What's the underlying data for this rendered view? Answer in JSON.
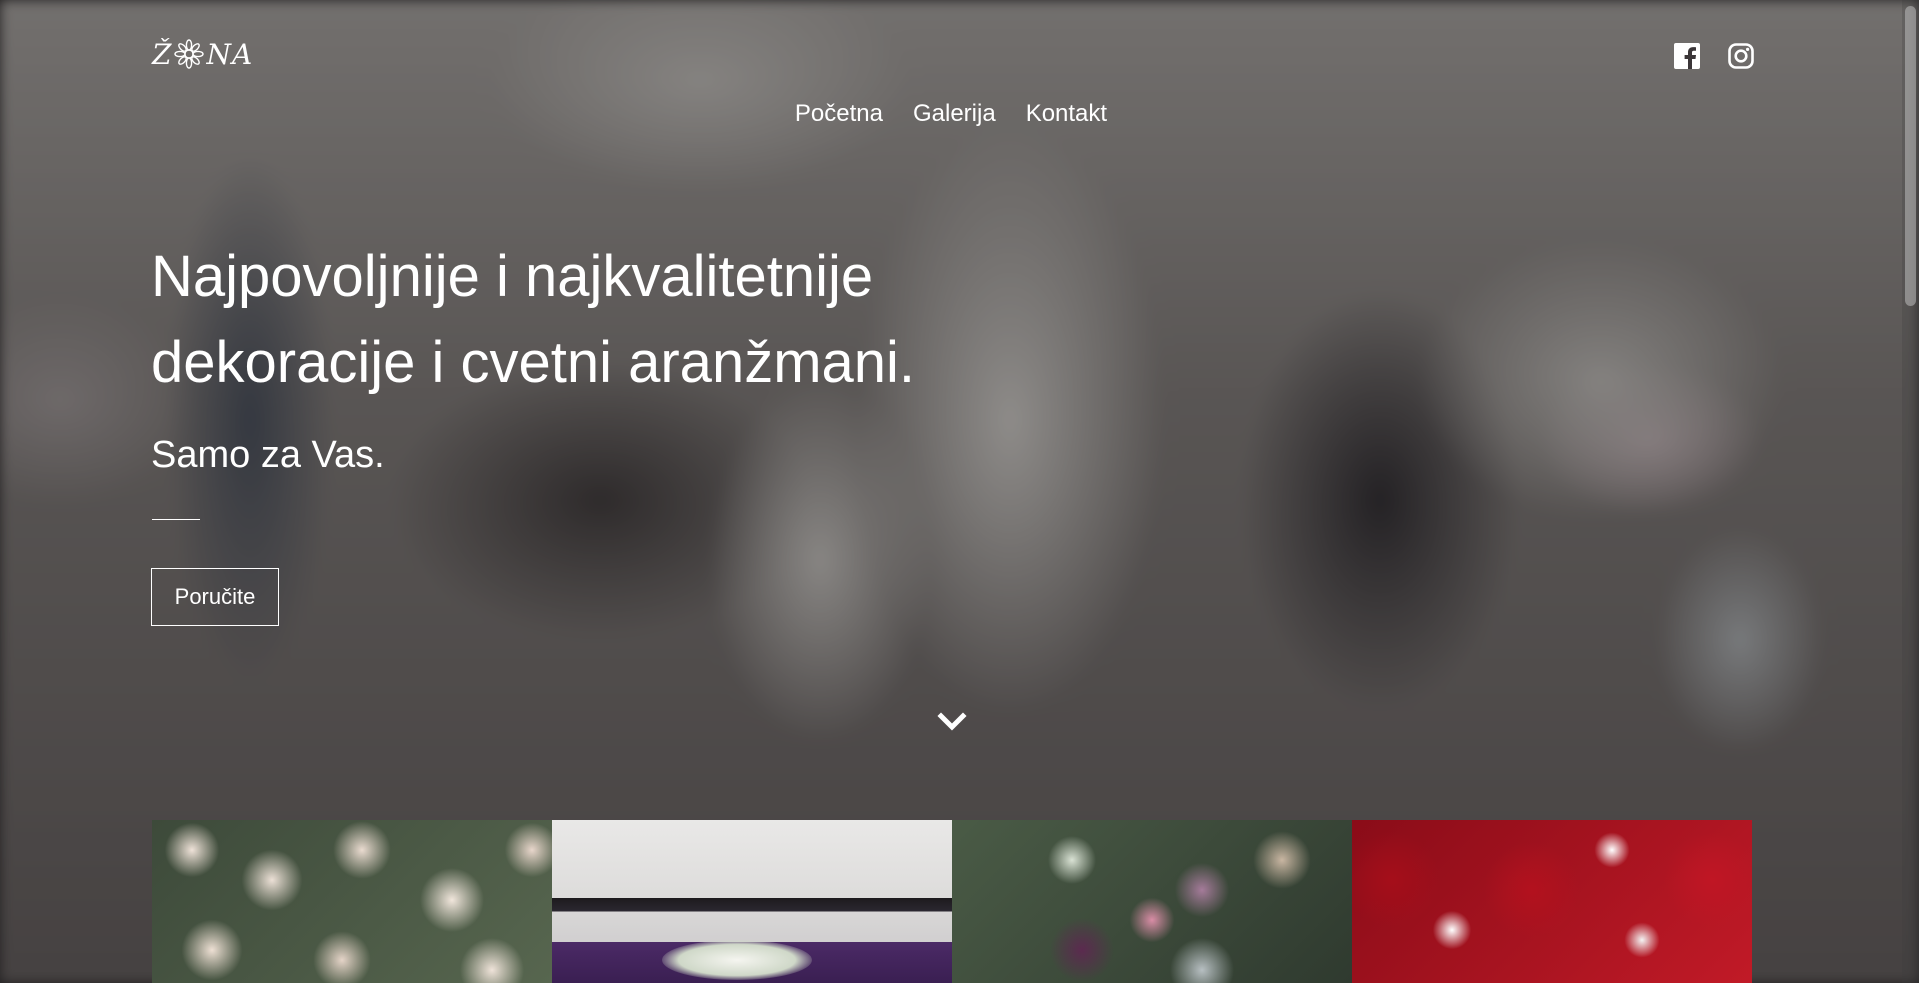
{
  "brand": {
    "logo_alt": "ŽENA"
  },
  "social": {
    "facebook_icon": "facebook-icon",
    "instagram_icon": "instagram-icon"
  },
  "nav": {
    "items": [
      {
        "label": "Početna"
      },
      {
        "label": "Galerija"
      },
      {
        "label": "Kontakt"
      }
    ]
  },
  "hero": {
    "headline_line1": "Najpovoljnije i najkvalitetnije",
    "headline_line2": "dekoracije i cvetni aranžmani.",
    "subline": "Samo za Vas.",
    "cta_label": "Poručite",
    "scroll_icon": "chevron-down-icon"
  },
  "gallery": {
    "tiles": [
      "roses-bouquet",
      "table-decoration",
      "mixed-bouquet",
      "red-roses-bouquet"
    ]
  },
  "colors": {
    "text": "#ffffff",
    "overlay": "#141416"
  }
}
